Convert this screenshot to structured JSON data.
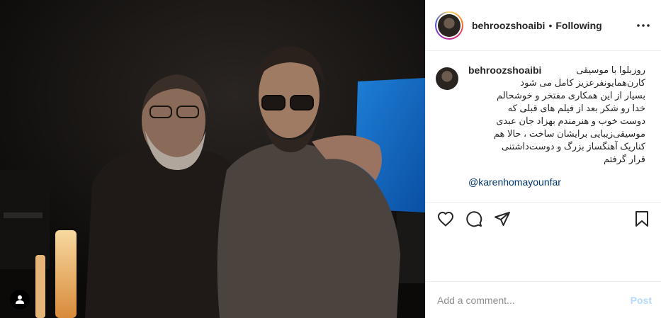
{
  "post": {
    "username": "behroozshoaibi",
    "follow_status": "Following",
    "separator": "•"
  },
  "caption": {
    "text": "روزبلوا با موسیقی\nکارن‌همایونفرعزیز کامل می شود\nبسیار از این همکاری مفتخر و خوشحالم\nخدا رو شکر بعد از فیلم های قبلی که\nدوست خوب و هنرمندم بهزاد جان عبدی\nموسیقی‌زیبایی برایشان ساخت ، حالا هم\nکناریک آهنگساز بزرگ و دوست‌داشتنی\nقرار گرفتم",
    "mention": "@karenhomayounfar"
  },
  "comment": {
    "placeholder": "Add a comment...",
    "value": "",
    "post_label": "Post"
  },
  "icons": {
    "more": "more-horizontal-icon",
    "like": "heart-icon",
    "comment": "comment-bubble-icon",
    "share": "paper-plane-icon",
    "save": "bookmark-icon",
    "tagged": "user-tag-icon"
  },
  "colors": {
    "text": "#262626",
    "muted": "#8e8e8e",
    "link": "#00376b",
    "post_disabled": "#b3dbff",
    "border": "#efefef"
  }
}
